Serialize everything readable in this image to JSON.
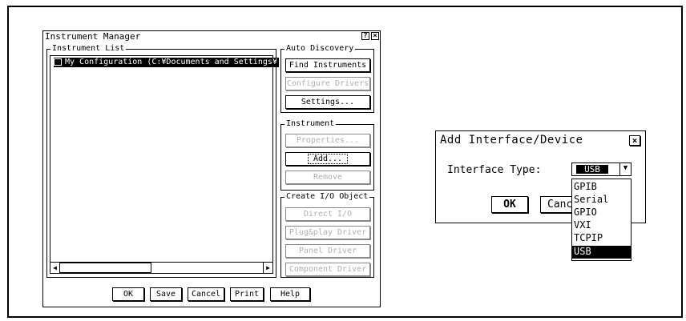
{
  "instrument_manager": {
    "title": "Instrument Manager",
    "help_btn": "?",
    "close_btn": "×",
    "instrument_list": {
      "label": "Instrument List",
      "items": [
        "My Configuration (C:¥Documents and Settings¥"
      ]
    },
    "auto_discovery": {
      "label": "Auto Discovery",
      "find": "Find Instruments",
      "configure": "Configure Drivers",
      "settings": "Settings..."
    },
    "instrument": {
      "label": "Instrument",
      "properties": "Properties...",
      "add": "Add...",
      "remove": "Remove"
    },
    "create_io": {
      "label": "Create I/O Object",
      "direct": "Direct I/O",
      "plugplay": "Plug&play Driver",
      "panel": "Panel Driver",
      "component": "Component Driver"
    },
    "scroll_left": "◀",
    "scroll_right": "▶",
    "bottom_buttons": {
      "ok": "OK",
      "save": "Save",
      "cancel": "Cancel",
      "print": "Print",
      "help": "Help"
    }
  },
  "add_dialog": {
    "title": "Add Interface/Device",
    "close_btn": "×",
    "interface_label": "Interface Type:",
    "selected_value": "USB",
    "dropdown_arrow": "▼",
    "options": [
      "GPIB",
      "Serial",
      "GPIO",
      "VXI",
      "TCPIP",
      "USB"
    ],
    "ok": "OK",
    "cancel_partial": "Canc"
  }
}
